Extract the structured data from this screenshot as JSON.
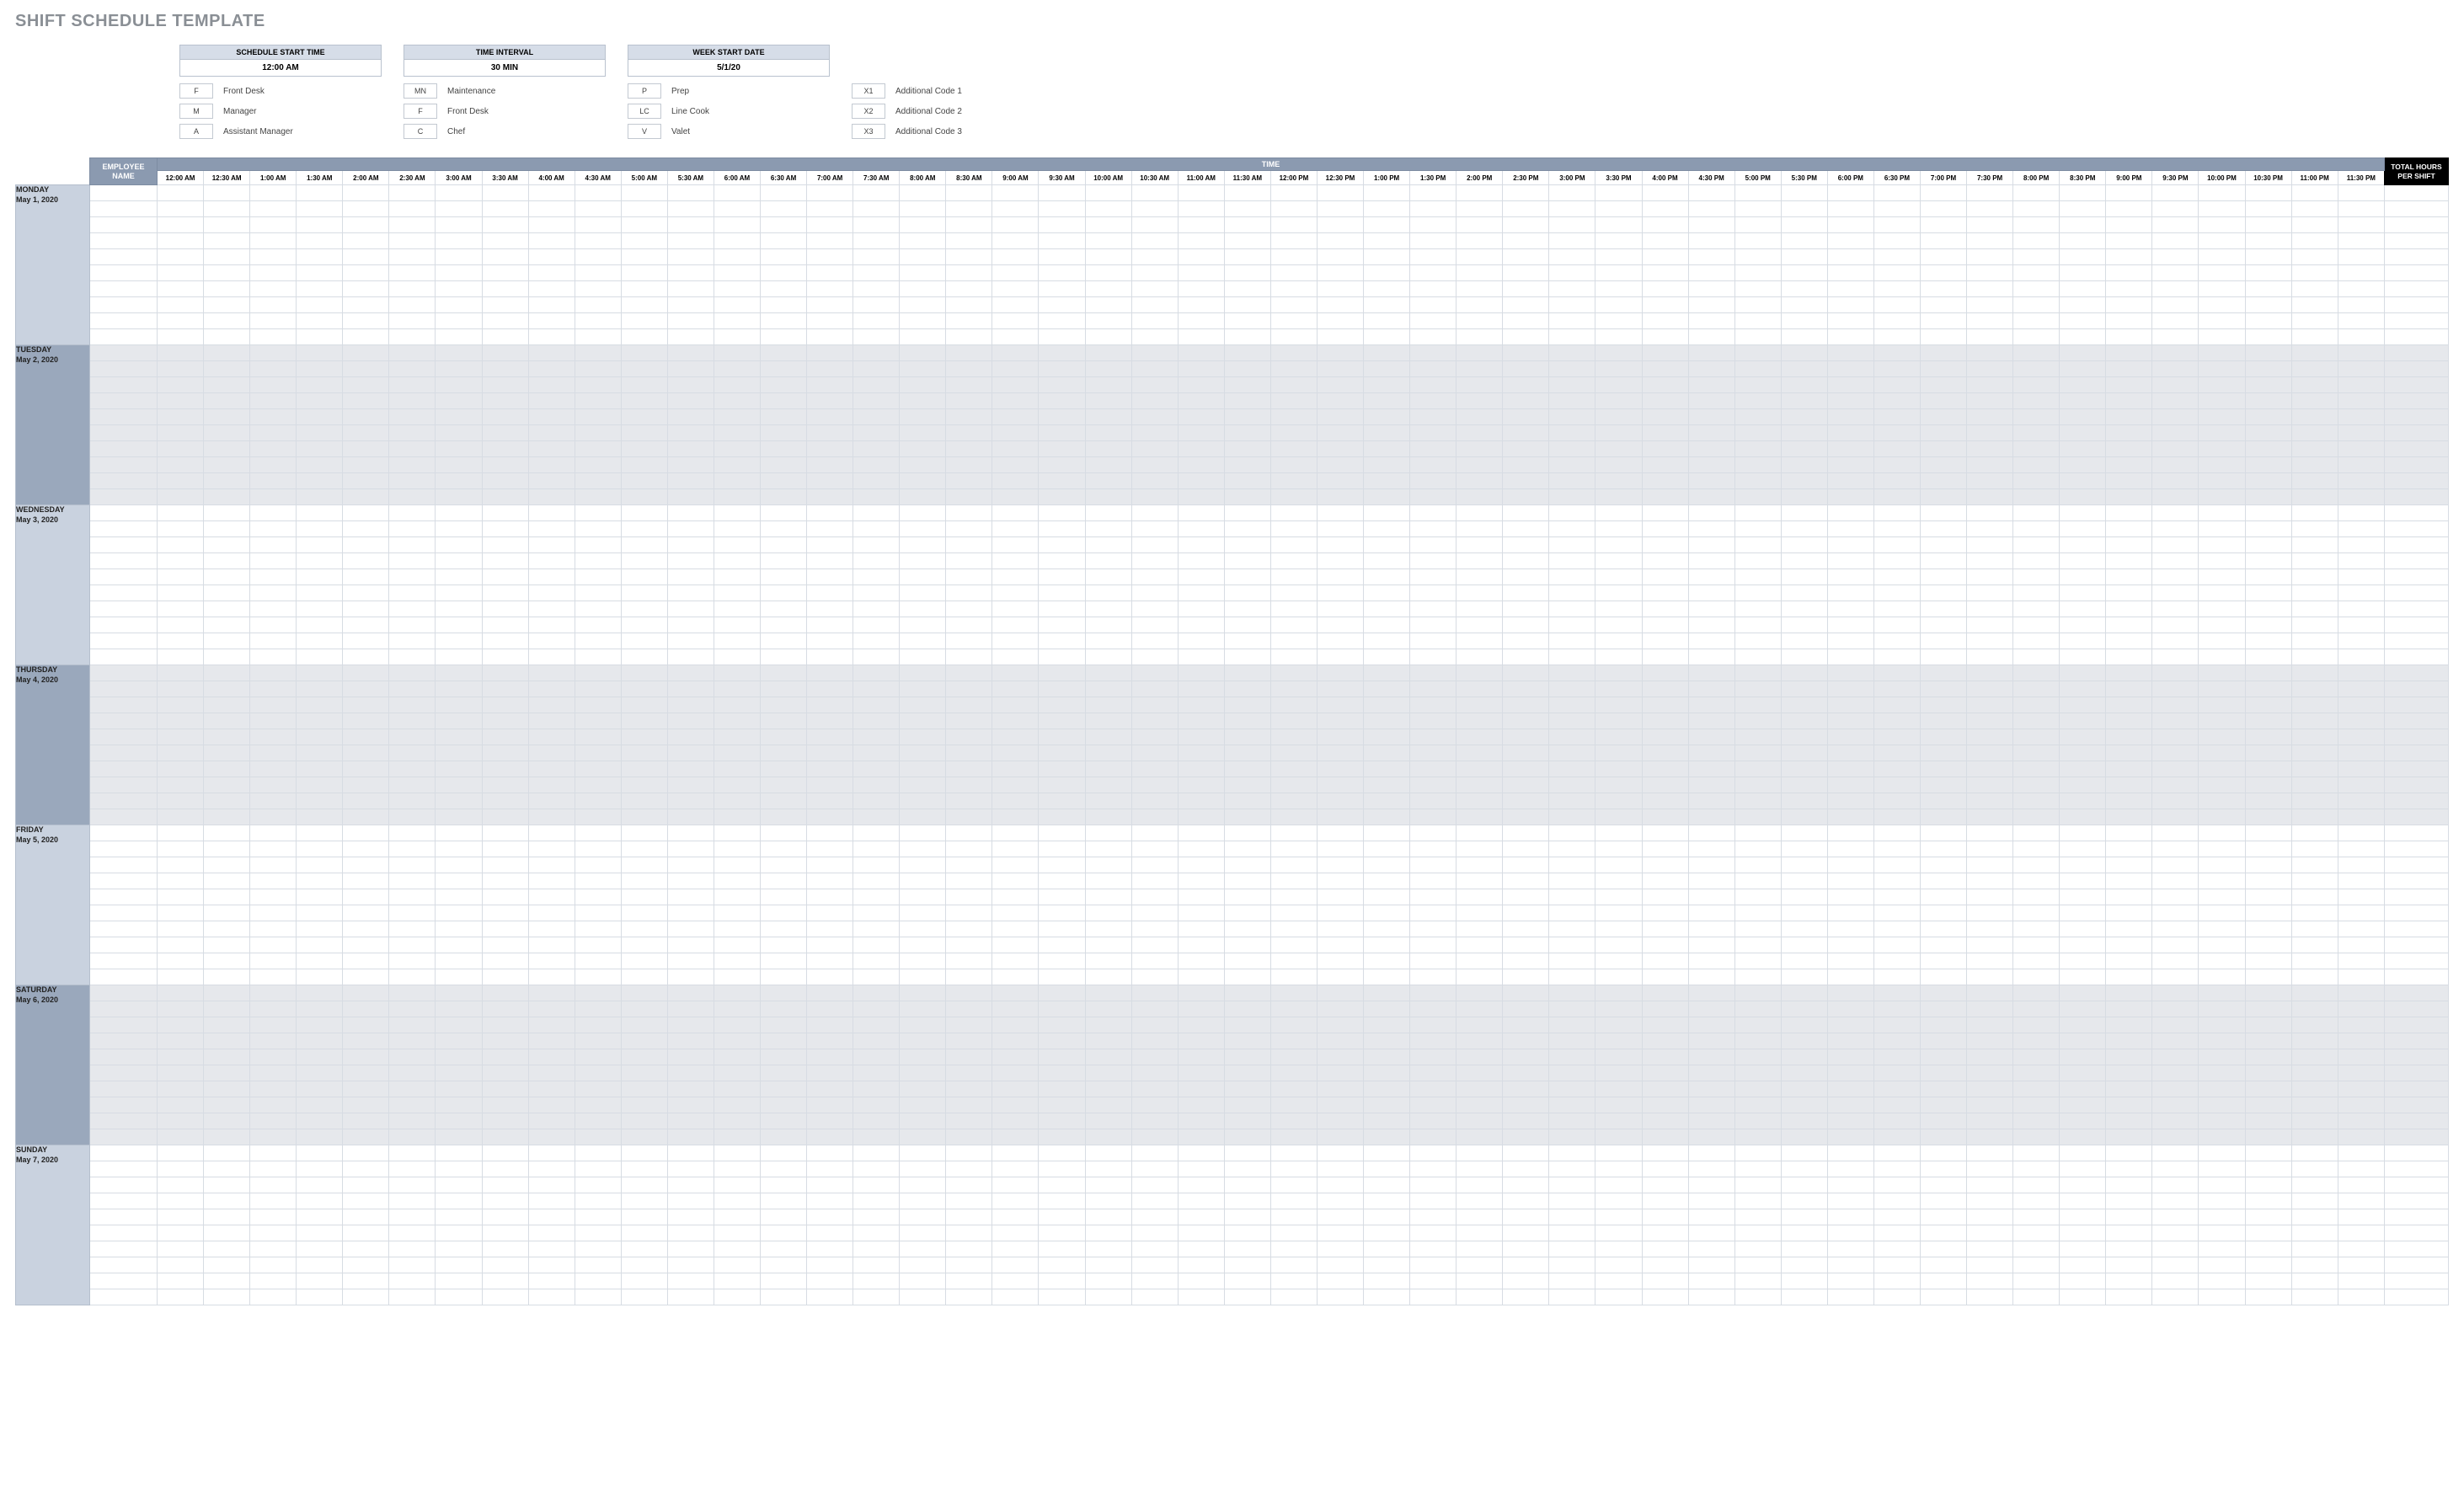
{
  "title": "SHIFT SCHEDULE TEMPLATE",
  "controls": [
    {
      "label": "SCHEDULE START TIME",
      "value": "12:00 AM"
    },
    {
      "label": "TIME INTERVAL",
      "value": "30 MIN"
    },
    {
      "label": "WEEK START DATE",
      "value": "5/1/20"
    }
  ],
  "legend": [
    [
      {
        "code": "F",
        "label": "Front Desk"
      },
      {
        "code": "M",
        "label": "Manager"
      },
      {
        "code": "A",
        "label": "Assistant Manager"
      }
    ],
    [
      {
        "code": "MN",
        "label": "Maintenance"
      },
      {
        "code": "F",
        "label": "Front Desk"
      },
      {
        "code": "C",
        "label": "Chef"
      }
    ],
    [
      {
        "code": "P",
        "label": "Prep"
      },
      {
        "code": "LC",
        "label": "Line Cook"
      },
      {
        "code": "V",
        "label": "Valet"
      }
    ],
    [
      {
        "code": "X1",
        "label": "Additional Code 1"
      },
      {
        "code": "X2",
        "label": "Additional Code 2"
      },
      {
        "code": "X3",
        "label": "Additional Code 3"
      }
    ]
  ],
  "header": {
    "employee": "EMPLOYEE NAME",
    "time_group": "TIME",
    "total": "TOTAL HOURS PER SHIFT"
  },
  "times": [
    "12:00 AM",
    "12:30 AM",
    "1:00 AM",
    "1:30 AM",
    "2:00 AM",
    "2:30 AM",
    "3:00 AM",
    "3:30 AM",
    "4:00 AM",
    "4:30 AM",
    "5:00 AM",
    "5:30 AM",
    "6:00 AM",
    "6:30 AM",
    "7:00 AM",
    "7:30 AM",
    "8:00 AM",
    "8:30 AM",
    "9:00 AM",
    "9:30 AM",
    "10:00 AM",
    "10:30 AM",
    "11:00 AM",
    "11:30 AM",
    "12:00 PM",
    "12:30 PM",
    "1:00 PM",
    "1:30 PM",
    "2:00 PM",
    "2:30 PM",
    "3:00 PM",
    "3:30 PM",
    "4:00 PM",
    "4:30 PM",
    "5:00 PM",
    "5:30 PM",
    "6:00 PM",
    "6:30 PM",
    "7:00 PM",
    "7:30 PM",
    "8:00 PM",
    "8:30 PM",
    "9:00 PM",
    "9:30 PM",
    "10:00 PM",
    "10:30 PM",
    "11:00 PM",
    "11:30 PM"
  ],
  "days": [
    {
      "name": "MONDAY",
      "date": "May 1, 2020",
      "shade": false,
      "rows": 10
    },
    {
      "name": "TUESDAY",
      "date": "May 2, 2020",
      "shade": true,
      "rows": 10
    },
    {
      "name": "WEDNESDAY",
      "date": "May 3, 2020",
      "shade": false,
      "rows": 10
    },
    {
      "name": "THURSDAY",
      "date": "May 4, 2020",
      "shade": true,
      "rows": 10
    },
    {
      "name": "FRIDAY",
      "date": "May 5, 2020",
      "shade": false,
      "rows": 10
    },
    {
      "name": "SATURDAY",
      "date": "May 6, 2020",
      "shade": true,
      "rows": 10
    },
    {
      "name": "SUNDAY",
      "date": "May 7, 2020",
      "shade": false,
      "rows": 10
    }
  ]
}
